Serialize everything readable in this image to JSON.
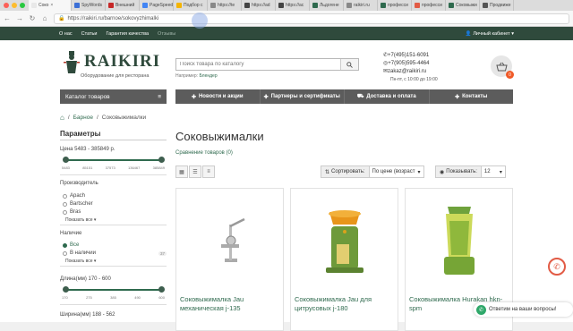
{
  "browser": {
    "tabs": [
      {
        "label": "Соко",
        "color": "#e8e8e8",
        "active": true
      },
      {
        "label": "SpyWords",
        "color": "#3b6fd6"
      },
      {
        "label": "Внешний",
        "color": "#c62828"
      },
      {
        "label": "PageSpeed",
        "color": "#4285f4"
      },
      {
        "label": "Подбор с",
        "color": "#f4b400"
      },
      {
        "label": "https://te",
        "color": "#888888"
      },
      {
        "label": "https://ad",
        "color": "#444444"
      },
      {
        "label": "https://ac",
        "color": "#444444"
      },
      {
        "label": "Льдогене",
        "color": "#2f6a4e"
      },
      {
        "label": "raikiri.ru",
        "color": "#888888"
      },
      {
        "label": "професси",
        "color": "#2f6a4e"
      },
      {
        "label": "професси",
        "color": "#e25b45"
      },
      {
        "label": "Соковыжи",
        "color": "#2f6a4e"
      },
      {
        "label": "Продвиже",
        "color": "#555555"
      }
    ],
    "url": "https://raikiri.ru/barnoe/sokovyzhimalki",
    "back_glyph": "←",
    "forward_glyph": "→",
    "reload_glyph": "↻",
    "home_glyph": "⌂",
    "close_glyph": "×"
  },
  "topnav": {
    "links": [
      "О нас",
      "Статьи",
      "Гарантия качества"
    ],
    "muted_link": "Отзывы",
    "cabinet": "Личный кабинет",
    "cabinet_caret": "▾"
  },
  "header": {
    "logo": "RAIKIRI",
    "logo_sub": "Оборудование для ресторана",
    "search_placeholder": "Поиск товара по каталогу",
    "example_prefix": "Например:",
    "example_value": "Блендер",
    "phone1": "+7(495)151-6091",
    "phone2": "+7(905)595-4464",
    "email": "zakaz@raikiri.ru",
    "schedule": "Пн-пт, с 10:00 до 19:00",
    "cart_count": "0"
  },
  "mainnav": {
    "catalog": "Каталог товаров",
    "catalog_glyph": "≡",
    "items": [
      {
        "label": "Новости и акции",
        "icon": "✚"
      },
      {
        "label": "Партнеры и сертификаты",
        "icon": "✚"
      },
      {
        "label": "Доставка и оплата",
        "icon": "⛟"
      },
      {
        "label": "Контакты",
        "icon": "✚"
      }
    ]
  },
  "breadcrumb": {
    "home_icon": "⌂",
    "sep": "/",
    "items": [
      "Барное",
      "Соковыжималки"
    ]
  },
  "sidebar": {
    "title": "Параметры",
    "price_label": "Цена",
    "price_range": "5483 - 385849 р.",
    "price_ticks": [
      "5483",
      "85151",
      "37573",
      "136467",
      "385849"
    ],
    "manufacturer_label": "Производитель",
    "manufacturers": [
      "Apach",
      "Bartscher",
      "Bras"
    ],
    "show_all": "Показать все",
    "show_all_caret": "▾",
    "availability_label": "Наличие",
    "availability": [
      {
        "label": "Все",
        "active": true
      },
      {
        "label": "В наличии",
        "count": "37",
        "active": false
      }
    ],
    "length_label": "Длина(мм)",
    "length_range": "170 - 600",
    "length_ticks": [
      "170",
      "275",
      "385",
      "490",
      "600"
    ],
    "width_label": "Ширина(мм)",
    "width_range": "188 - 562"
  },
  "main": {
    "title": "Соковыжималки",
    "compare": "Сравнение товаров (0)",
    "sort_label": "Сортировать:",
    "sort_value": "По цене (возраст",
    "show_label": "Показывать:",
    "show_value": "12",
    "caret": "▾",
    "products": [
      {
        "name": "Соковыжималка Jau механическая j-135"
      },
      {
        "name": "Соковыжималка Jau для цитрусовых j-180"
      },
      {
        "name": "Соковыжималка Hurakan hkn-spm"
      }
    ]
  },
  "widgets": {
    "chat": "Ответим на ваши вопросы!",
    "chat_icon": "✆",
    "phone_icon": "✆"
  }
}
